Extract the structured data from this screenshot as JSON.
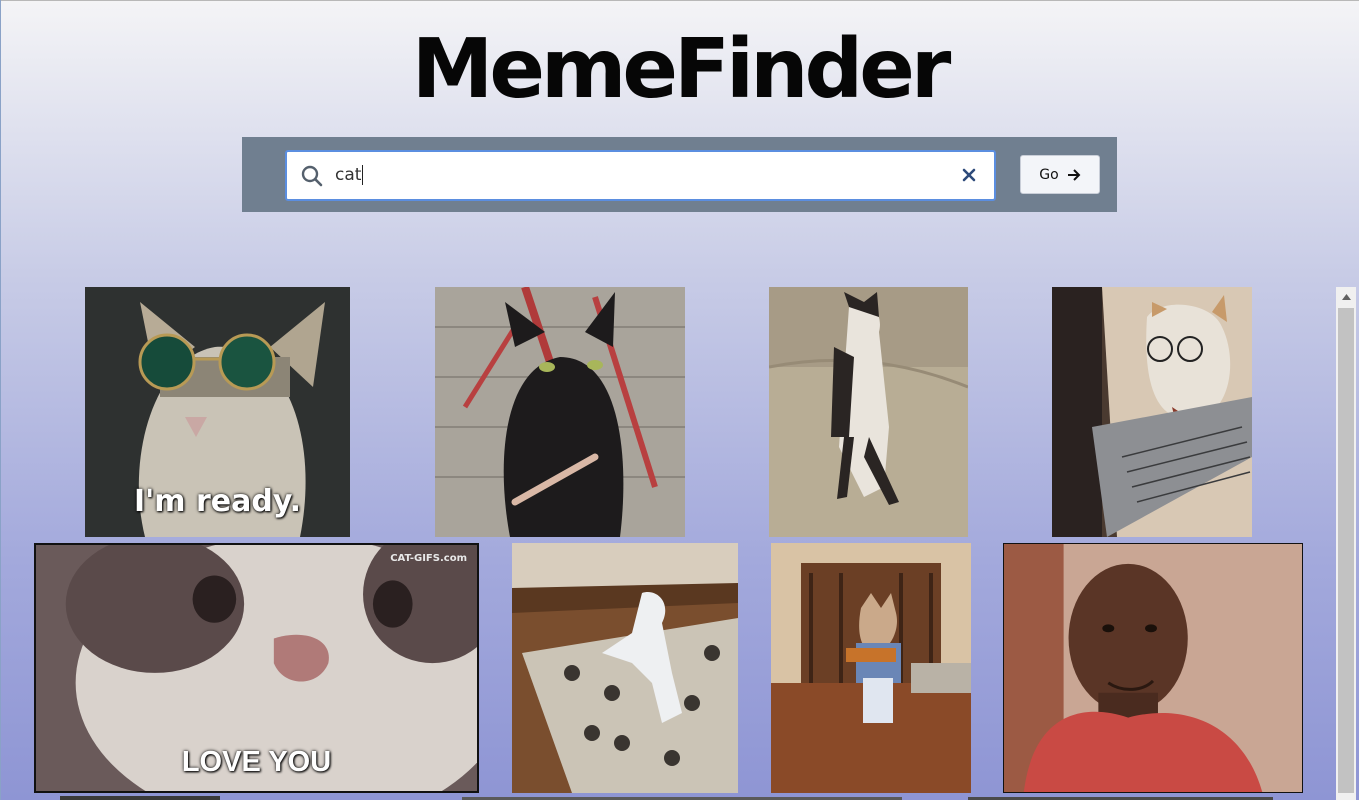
{
  "app": {
    "title": "MemeFinder"
  },
  "search": {
    "query": "cat",
    "go_label": "Go"
  },
  "results": {
    "tiles": [
      {
        "subject": "cat with round sunglasses",
        "caption": "I'm ready."
      },
      {
        "subject": "black cat filing nails",
        "caption": ""
      },
      {
        "subject": "standing dancing cat",
        "caption": ""
      },
      {
        "subject": "cat with glasses at laptop",
        "caption": ""
      },
      {
        "subject": "cat close-up face",
        "caption": "LOVE YOU",
        "watermark": "CAT-GIFS.com"
      },
      {
        "subject": "white cat dancing on rug",
        "caption": ""
      },
      {
        "subject": "cat playing guitar",
        "caption": ""
      },
      {
        "subject": "man in red shirt smiling",
        "caption": ""
      }
    ]
  }
}
